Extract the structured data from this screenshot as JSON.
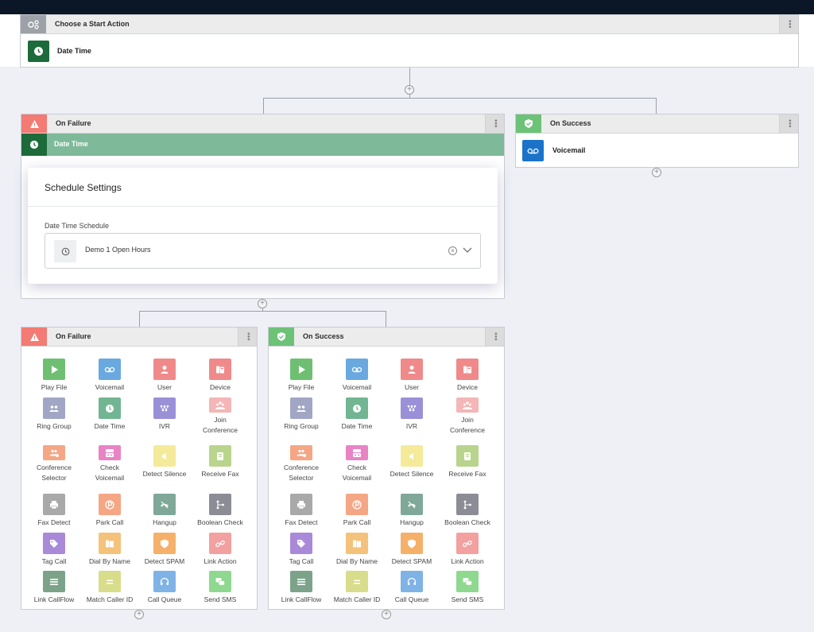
{
  "start": {
    "header": "Choose a Start Action",
    "action": "Date Time"
  },
  "level1": {
    "failure": {
      "header": "On Failure",
      "action": "Date Time"
    },
    "success": {
      "header": "On Success",
      "action": "Voicemail"
    }
  },
  "schedule": {
    "title": "Schedule Settings",
    "field_label": "Date Time Schedule",
    "selected": "Demo 1 Open Hours"
  },
  "level2": {
    "failure_header": "On Failure",
    "success_header": "On Success"
  },
  "actions": [
    {
      "label": "Play File",
      "icon": "play-icon",
      "color": "#6fbf73"
    },
    {
      "label": "Voicemail",
      "icon": "voicemail-icon",
      "color": "#6aa9e0"
    },
    {
      "label": "User",
      "icon": "user-icon",
      "color": "#f08a8a"
    },
    {
      "label": "Device",
      "icon": "device-icon",
      "color": "#f08a8a"
    },
    {
      "label": "Ring Group",
      "icon": "group-icon",
      "color": "#a1a6c4"
    },
    {
      "label": "Date Time",
      "icon": "clock-icon",
      "color": "#72b592"
    },
    {
      "label": "IVR",
      "icon": "ivr-icon",
      "color": "#9a90d8"
    },
    {
      "label": "Join\nConference",
      "icon": "conference-icon",
      "color": "#f4b6b6"
    },
    {
      "label": "Conference\nSelector",
      "icon": "conference-selector-icon",
      "color": "#f5a684"
    },
    {
      "label": "Check\nVoicemail",
      "icon": "check-voicemail-icon",
      "color": "#e984c4"
    },
    {
      "label": "Detect Silence",
      "icon": "silence-icon",
      "color": "#f4ea9a"
    },
    {
      "label": "Receive Fax",
      "icon": "fax-icon",
      "color": "#b9d48c"
    },
    {
      "label": "Fax Detect",
      "icon": "printer-icon",
      "color": "#a9a9a9"
    },
    {
      "label": "Park Call",
      "icon": "park-icon",
      "color": "#f5a684"
    },
    {
      "label": "Hangup",
      "icon": "hangup-icon",
      "color": "#7fa899"
    },
    {
      "label": "Boolean Check",
      "icon": "branch-icon",
      "color": "#8c8c96"
    },
    {
      "label": "Tag Call",
      "icon": "tag-icon",
      "color": "#a98ad8"
    },
    {
      "label": "Dial By Name",
      "icon": "dial-by-name-icon",
      "color": "#f4c27a"
    },
    {
      "label": "Detect SPAM",
      "icon": "shield-icon",
      "color": "#f5b06a"
    },
    {
      "label": "Link Action",
      "icon": "link-icon",
      "color": "#f2a0a0"
    },
    {
      "label": "Link CallFlow",
      "icon": "callflow-icon",
      "color": "#7ca38a"
    },
    {
      "label": "Match Caller ID",
      "icon": "equals-icon",
      "color": "#d7dd8a"
    },
    {
      "label": "Call Queue",
      "icon": "headset-icon",
      "color": "#7fb3e6"
    },
    {
      "label": "Send SMS",
      "icon": "sms-icon",
      "color": "#8fd88f"
    }
  ]
}
